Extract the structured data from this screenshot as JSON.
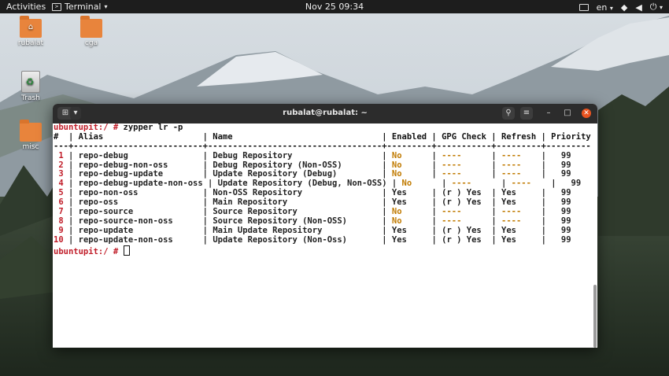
{
  "topbar": {
    "activities": "Activities",
    "app_name": "Terminal",
    "clock": "Nov 25  09:34",
    "language": "en"
  },
  "desktop": {
    "icons": [
      {
        "label": "rubalat",
        "kind": "home-folder"
      },
      {
        "label": "cga",
        "kind": "folder"
      },
      {
        "label": "Trash",
        "kind": "trash"
      },
      {
        "label": "misc",
        "kind": "folder"
      }
    ]
  },
  "window": {
    "title": "rubalat@rubalat: ~"
  },
  "terminal": {
    "prompt": "ubuntupit:/ #",
    "command": "zypper lr -p",
    "header": "#  | Alias                    | Name                              | Enabled | GPG Check | Refresh | Priority",
    "separator": "---+--------------------------+-----------------------------------+---------+-----------+---------+---------",
    "rows": [
      {
        "num": "1",
        "alias": "repo-debug",
        "name": "Debug Repository",
        "enabled": "No",
        "gpg": "----",
        "refresh": "----",
        "priority": "99"
      },
      {
        "num": "2",
        "alias": "repo-debug-non-oss",
        "name": "Debug Repository (Non-OSS)",
        "enabled": "No",
        "gpg": "----",
        "refresh": "----",
        "priority": "99"
      },
      {
        "num": "3",
        "alias": "repo-debug-update",
        "name": "Update Repository (Debug)",
        "enabled": "No",
        "gpg": "----",
        "refresh": "----",
        "priority": "99"
      },
      {
        "num": "4",
        "alias": "repo-debug-update-non-oss",
        "name": "Update Repository (Debug, Non-OSS)",
        "enabled": "No",
        "gpg": "----",
        "refresh": "----",
        "priority": "99"
      },
      {
        "num": "5",
        "alias": "repo-non-oss",
        "name": "Non-OSS Repository",
        "enabled": "Yes",
        "gpg": "(r ) Yes",
        "refresh": "Yes",
        "priority": "99"
      },
      {
        "num": "6",
        "alias": "repo-oss",
        "name": "Main Repository",
        "enabled": "Yes",
        "gpg": "(r ) Yes",
        "refresh": "Yes",
        "priority": "99"
      },
      {
        "num": "7",
        "alias": "repo-source",
        "name": "Source Repository",
        "enabled": "No",
        "gpg": "----",
        "refresh": "----",
        "priority": "99"
      },
      {
        "num": "8",
        "alias": "repo-source-non-oss",
        "name": "Source Repository (Non-OSS)",
        "enabled": "No",
        "gpg": "----",
        "refresh": "----",
        "priority": "99"
      },
      {
        "num": "9",
        "alias": "repo-update",
        "name": "Main Update Repository",
        "enabled": "Yes",
        "gpg": "(r ) Yes",
        "refresh": "Yes",
        "priority": "99"
      },
      {
        "num": "10",
        "alias": "repo-update-non-oss",
        "name": "Update Repository (Non-Oss)",
        "enabled": "Yes",
        "gpg": "(r ) Yes",
        "refresh": "Yes",
        "priority": "99"
      }
    ]
  },
  "colors": {
    "prompt": "#c01c28",
    "disabled": "#c07a00",
    "close_button": "#e95420"
  }
}
